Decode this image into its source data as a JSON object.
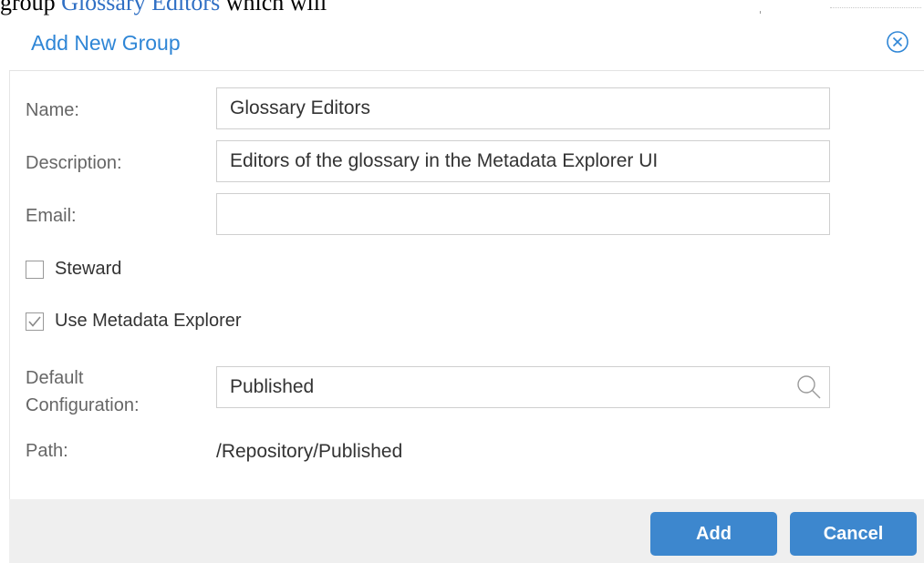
{
  "background": {
    "text_prefix": "group ",
    "link_text": "Glossary Editors",
    "text_suffix": " which will"
  },
  "dialog": {
    "title": "Add New Group",
    "close_icon": "close-circle-icon",
    "fields": {
      "name": {
        "label": "Name:",
        "value": "Glossary Editors"
      },
      "description": {
        "label": "Description:",
        "value": "Editors of the glossary in the Metadata Explorer UI"
      },
      "email": {
        "label": "Email:",
        "value": ""
      }
    },
    "checkboxes": {
      "steward": {
        "label": "Steward",
        "checked": false
      },
      "use_metadata_explorer": {
        "label": "Use Metadata Explorer",
        "checked": true
      }
    },
    "default_configuration": {
      "label_line1": "Default",
      "label_line2": "Configuration:",
      "value": "Published",
      "icon": "search-icon"
    },
    "path": {
      "label": "Path:",
      "value": "/Repository/Published"
    },
    "buttons": {
      "add": "Add",
      "cancel": "Cancel"
    }
  },
  "colors": {
    "title": "#2f86d6",
    "button": "#3d87ce",
    "footer": "#efefef",
    "link": "#2f6fc4"
  }
}
